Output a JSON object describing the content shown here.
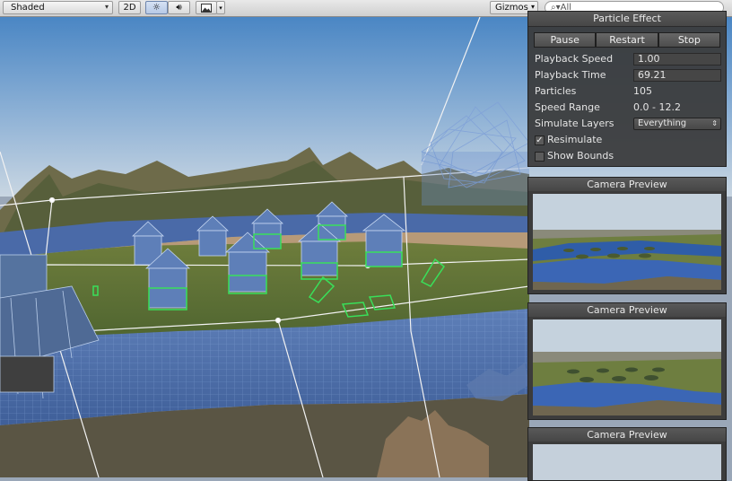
{
  "toolbar": {
    "draw_mode": "Shaded",
    "mode_2d": "2D",
    "gizmos": "Gizmos",
    "search_placeholder": "All"
  },
  "particle_panel": {
    "title": "Particle Effect",
    "buttons": {
      "pause": "Pause",
      "restart": "Restart",
      "stop": "Stop"
    },
    "rows": {
      "playback_speed": {
        "label": "Playback Speed",
        "value": "1.00"
      },
      "playback_time": {
        "label": "Playback Time",
        "value": "69.21"
      },
      "particles": {
        "label": "Particles",
        "value": "105"
      },
      "speed_range": {
        "label": "Speed Range",
        "value": "0.0 - 12.2"
      },
      "simulate_layers": {
        "label": "Simulate Layers",
        "value": "Everything"
      }
    },
    "resimulate": {
      "label": "Resimulate",
      "checked": true,
      "mark": "✓"
    },
    "show_bounds": {
      "label": "Show Bounds",
      "checked": false
    }
  },
  "camera_previews": [
    {
      "title": "Camera Preview"
    },
    {
      "title": "Camera Preview"
    },
    {
      "title": "Camera Preview"
    }
  ],
  "colors": {
    "accent_selection": "#6f86ad",
    "panel_bg": "#3a3a3a",
    "wireframe_blue": "#5f86c8",
    "gizmo_green": "#39e05a"
  }
}
